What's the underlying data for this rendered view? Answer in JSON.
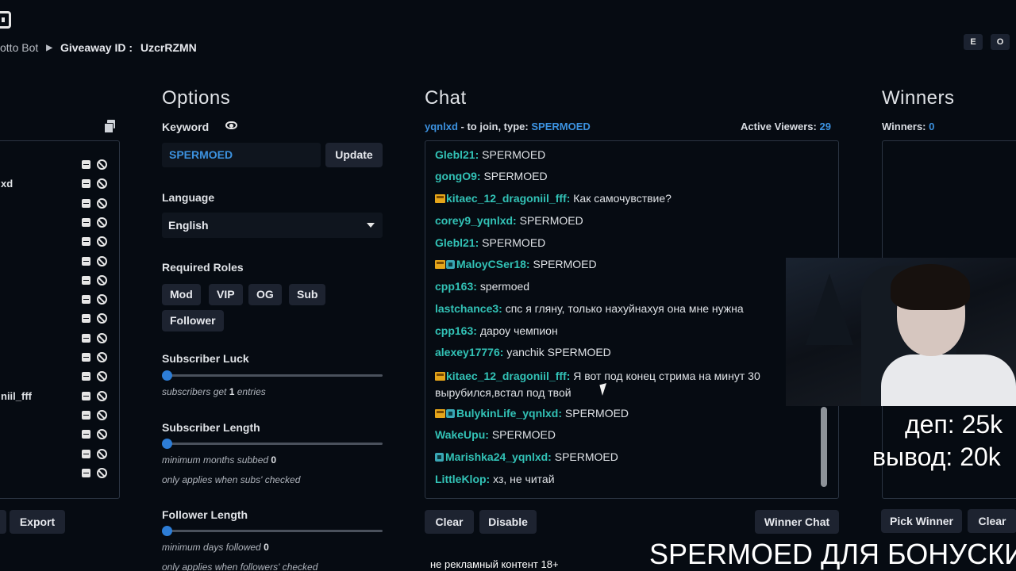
{
  "header": {
    "app_crumb": "otto Bot",
    "giveaway_label": "Giveaway ID :",
    "giveaway_id": "UzcrRZMN",
    "btn_e": "E",
    "btn_o": "O"
  },
  "entries": {
    "visible_names": [
      "xd",
      "niil_fff"
    ],
    "row_count": 17,
    "export_label": "Export"
  },
  "options": {
    "title": "Options",
    "keyword_label": "Keyword",
    "keyword_value": "SPERMOED",
    "update_label": "Update",
    "language_label": "Language",
    "language_value": "English",
    "roles_label": "Required Roles",
    "roles": [
      "Mod",
      "VIP",
      "OG",
      "Sub",
      "Follower"
    ],
    "sub_luck_label": "Subscriber Luck",
    "sub_luck_hint_pre": "subscribers get",
    "sub_luck_value": "1",
    "sub_luck_hint_post": "entries",
    "sub_length_label": "Subscriber Length",
    "sub_length_hint_pre": "minimum months subbed",
    "sub_length_value": "0",
    "sub_length_note": "only applies when subs' checked",
    "follower_length_label": "Follower Length",
    "follower_length_hint_pre": "minimum days followed",
    "follower_length_value": "0",
    "follower_length_note": "only applies when followers' checked"
  },
  "chat": {
    "title": "Chat",
    "join_user": "yqnlxd",
    "join_text": "- to join, type:",
    "join_keyword": "SPERMOED",
    "viewers_label": "Active Viewers:",
    "viewers_count": "29",
    "messages": [
      {
        "user": "Glebl21:",
        "text": "SPERMOED",
        "crown": false,
        "sub": false
      },
      {
        "user": "gongO9:",
        "text": "SPERMOED",
        "crown": false,
        "sub": false
      },
      {
        "user": "kitaec_12_dragoniil_fff:",
        "text": "Как самочувствие?",
        "crown": true,
        "sub": false
      },
      {
        "user": "corey9_yqnlxd:",
        "text": "SPERMOED",
        "crown": false,
        "sub": false
      },
      {
        "user": "Glebl21:",
        "text": "SPERMOED",
        "crown": false,
        "sub": false
      },
      {
        "user": "MaloyCSer18:",
        "text": "SPERMOED",
        "crown": true,
        "sub": true
      },
      {
        "user": "cpp163:",
        "text": "spermoed",
        "crown": false,
        "sub": false
      },
      {
        "user": "lastchance3:",
        "text": "спс я гляну, только нахуйнахуя она мне нужна",
        "crown": false,
        "sub": false
      },
      {
        "user": "cpp163:",
        "text": "дароу чемпион",
        "crown": false,
        "sub": false
      },
      {
        "user": "alexey17776:",
        "text": "yanchik SPERMOED",
        "crown": false,
        "sub": false
      },
      {
        "user": "kitaec_12_dragoniil_fff:",
        "text": "Я вот под конец стрима на минут 30 вырубился,встал под твой",
        "crown": true,
        "sub": false
      },
      {
        "user": "BulykinLife_yqnlxd:",
        "text": "SPERMOED",
        "crown": true,
        "sub": true
      },
      {
        "user": "WakeUpu:",
        "text": "SPERMOED",
        "crown": false,
        "sub": false
      },
      {
        "user": "Marishka24_yqnlxd:",
        "text": "SPERMOED",
        "crown": false,
        "sub": true
      },
      {
        "user": "LittleKlop:",
        "text": "хз, не читай",
        "crown": false,
        "sub": false
      }
    ],
    "clear_label": "Clear",
    "disable_label": "Disable",
    "winner_chat_label": "Winner Chat"
  },
  "winners": {
    "title": "Winners",
    "count_label": "Winners:",
    "count": "0",
    "pick_label": "Pick Winner",
    "clear_label": "Clear"
  },
  "overlay": {
    "dep": "деп: 25k",
    "out": "вывод: 20k",
    "notice": "не рекламный контент 18+",
    "promo": "SPERMOED ДЛЯ БОНУСКИ"
  },
  "colors": {
    "accent_blue": "#3c92e0",
    "username_teal": "#32c2b6",
    "background": "#060b12"
  }
}
